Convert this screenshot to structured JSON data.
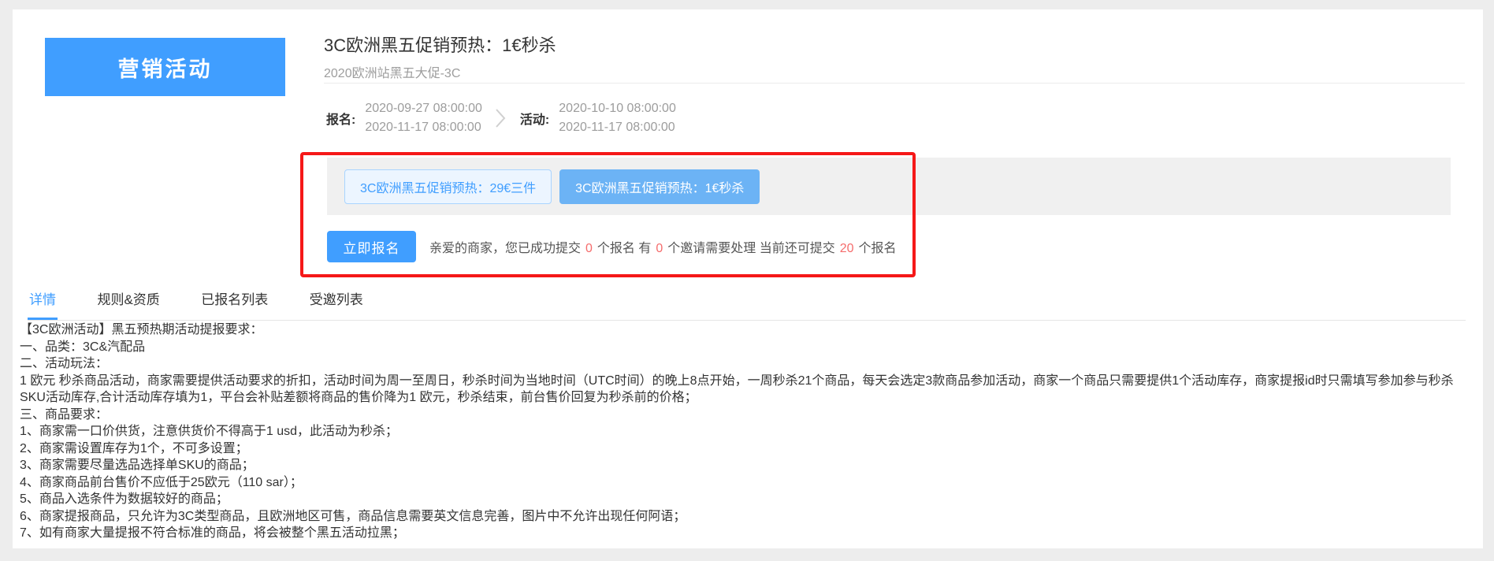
{
  "colors": {
    "accent": "#409eff",
    "session_active_bg": "#6cb3f5",
    "session_plain_bg": "#ecf5ff",
    "annotation_red": "#f51818",
    "number_red": "#f56c6c"
  },
  "banner": {
    "label": "营销活动"
  },
  "header": {
    "title": "3C欧洲黑五促销预热：1€秒杀",
    "subtitle": "2020欧洲站黑五大促-3C"
  },
  "schedule": {
    "signup_label": "报名:",
    "signup_start": "2020-09-27 08:00:00",
    "signup_end": "2020-11-17 08:00:00",
    "arrow_icon": "chevron-right",
    "activity_label": "活动:",
    "activity_start": "2020-10-10 08:00:00",
    "activity_end": "2020-11-17 08:00:00"
  },
  "sessions": [
    {
      "label": "3C欧洲黑五促销预热：29€三件",
      "active": false
    },
    {
      "label": "3C欧洲黑五促销预热：1€秒杀",
      "active": true
    }
  ],
  "signup": {
    "button_label": "立即报名",
    "message": {
      "seg1": "亲爱的商家，您已成功提交",
      "submitted_count": "0",
      "seg2": "个报名 有",
      "invite_count": "0",
      "seg3": "个邀请需要处理 当前还可提交",
      "remaining_count": "20",
      "seg4": "个报名"
    }
  },
  "tabs": [
    {
      "label": "详情",
      "active": true
    },
    {
      "label": "规则&资质",
      "active": false
    },
    {
      "label": "已报名列表",
      "active": false
    },
    {
      "label": "受邀列表",
      "active": false
    }
  ],
  "detail": {
    "lines": [
      "【3C欧洲活动】黑五预热期活动提报要求：",
      "一、品类：3C&汽配品",
      "二、活动玩法：",
      "1 欧元 秒杀商品活动，商家需要提供活动要求的折扣，活动时间为周一至周日，秒杀时间为当地时间（UTC时间）的晚上8点开始，一周秒杀21个商品，每天会选定3款商品参加活动，商家一个商品只需要提供1个活动库存，商家提报id时只需填写参加参与秒杀SKU活动库存,合计活动库存填为1，平台会补贴差额将商品的售价降为1 欧元，秒杀结束，前台售价回复为秒杀前的价格；",
      "三、商品要求：",
      "1、商家需一口价供货，注意供货价不得高于1 usd，此活动为秒杀；",
      "2、商家需设置库存为1个，不可多设置；",
      "3、商家需要尽量选品选择单SKU的商品；",
      "4、商家商品前台售价不应低于25欧元（110 sar）；",
      "5、商品入选条件为数据较好的商品；",
      "6、商家提报商品，只允许为3C类型商品，且欧洲地区可售，商品信息需要英文信息完善，图片中不允许出现任何阿语；",
      "7、如有商家大量提报不符合标准的商品，将会被整个黑五活动拉黑；"
    ]
  }
}
